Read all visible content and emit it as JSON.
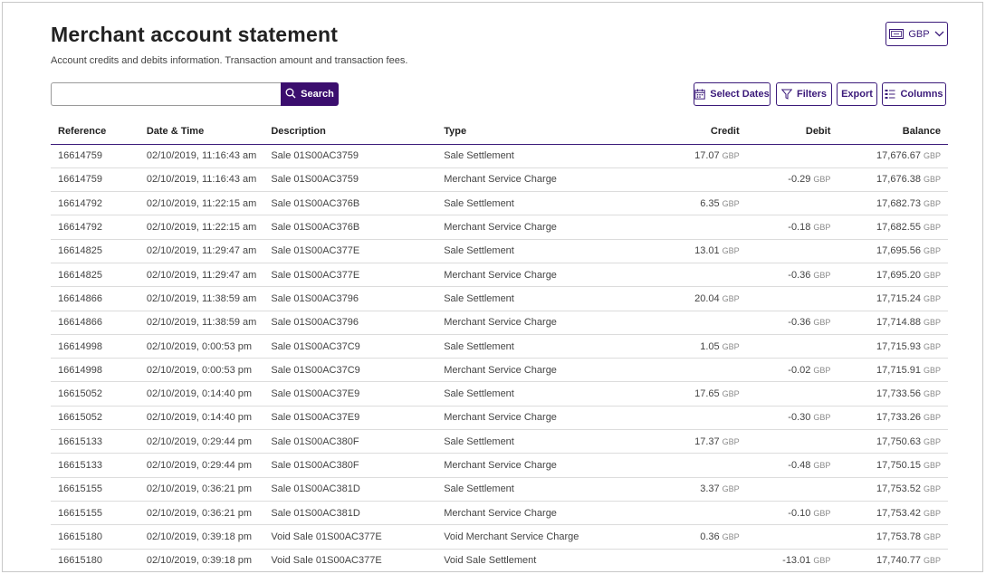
{
  "header": {
    "title": "Merchant account statement",
    "subtitle": "Account credits and debits information. Transaction amount and transaction fees.",
    "currency_label": "GBP"
  },
  "search": {
    "placeholder": "",
    "value": "",
    "button_label": "Search"
  },
  "toolbar": {
    "select_dates_label": "Select Dates",
    "filters_label": "Filters",
    "export_label": "Export",
    "columns_label": "Columns"
  },
  "colors": {
    "accent": "#3b0e6e",
    "border": "#3b1a7a"
  },
  "icons": {
    "currency": "banknote-icon",
    "dropdown": "chevron-down-icon",
    "search": "search-icon",
    "dates": "calendar-icon",
    "filters": "funnel-icon",
    "columns": "columns-icon"
  },
  "table": {
    "headers": [
      "Reference",
      "Date & Time",
      "Description",
      "Type",
      "Credit",
      "Debit",
      "Balance"
    ],
    "currency": "GBP",
    "rows": [
      {
        "ref": "16614759",
        "datetime": "02/10/2019, 11:16:43 am",
        "desc": "Sale 01S00AC3759",
        "type": "Sale Settlement",
        "credit": "17.07",
        "debit": "",
        "balance": "17,676.67"
      },
      {
        "ref": "16614759",
        "datetime": "02/10/2019, 11:16:43 am",
        "desc": "Sale 01S00AC3759",
        "type": "Merchant Service Charge",
        "credit": "",
        "debit": "-0.29",
        "balance": "17,676.38"
      },
      {
        "ref": "16614792",
        "datetime": "02/10/2019, 11:22:15 am",
        "desc": "Sale 01S00AC376B",
        "type": "Sale Settlement",
        "credit": "6.35",
        "debit": "",
        "balance": "17,682.73"
      },
      {
        "ref": "16614792",
        "datetime": "02/10/2019, 11:22:15 am",
        "desc": "Sale 01S00AC376B",
        "type": "Merchant Service Charge",
        "credit": "",
        "debit": "-0.18",
        "balance": "17,682.55"
      },
      {
        "ref": "16614825",
        "datetime": "02/10/2019, 11:29:47 am",
        "desc": "Sale 01S00AC377E",
        "type": "Sale Settlement",
        "credit": "13.01",
        "debit": "",
        "balance": "17,695.56"
      },
      {
        "ref": "16614825",
        "datetime": "02/10/2019, 11:29:47 am",
        "desc": "Sale 01S00AC377E",
        "type": "Merchant Service Charge",
        "credit": "",
        "debit": "-0.36",
        "balance": "17,695.20"
      },
      {
        "ref": "16614866",
        "datetime": "02/10/2019, 11:38:59 am",
        "desc": "Sale 01S00AC3796",
        "type": "Sale Settlement",
        "credit": "20.04",
        "debit": "",
        "balance": "17,715.24"
      },
      {
        "ref": "16614866",
        "datetime": "02/10/2019, 11:38:59 am",
        "desc": "Sale 01S00AC3796",
        "type": "Merchant Service Charge",
        "credit": "",
        "debit": "-0.36",
        "balance": "17,714.88"
      },
      {
        "ref": "16614998",
        "datetime": "02/10/2019, 0:00:53 pm",
        "desc": "Sale 01S00AC37C9",
        "type": "Sale Settlement",
        "credit": "1.05",
        "debit": "",
        "balance": "17,715.93"
      },
      {
        "ref": "16614998",
        "datetime": "02/10/2019, 0:00:53 pm",
        "desc": "Sale 01S00AC37C9",
        "type": "Merchant Service Charge",
        "credit": "",
        "debit": "-0.02",
        "balance": "17,715.91"
      },
      {
        "ref": "16615052",
        "datetime": "02/10/2019, 0:14:40 pm",
        "desc": "Sale 01S00AC37E9",
        "type": "Sale Settlement",
        "credit": "17.65",
        "debit": "",
        "balance": "17,733.56"
      },
      {
        "ref": "16615052",
        "datetime": "02/10/2019, 0:14:40 pm",
        "desc": "Sale 01S00AC37E9",
        "type": "Merchant Service Charge",
        "credit": "",
        "debit": "-0.30",
        "balance": "17,733.26"
      },
      {
        "ref": "16615133",
        "datetime": "02/10/2019, 0:29:44 pm",
        "desc": "Sale 01S00AC380F",
        "type": "Sale Settlement",
        "credit": "17.37",
        "debit": "",
        "balance": "17,750.63"
      },
      {
        "ref": "16615133",
        "datetime": "02/10/2019, 0:29:44 pm",
        "desc": "Sale 01S00AC380F",
        "type": "Merchant Service Charge",
        "credit": "",
        "debit": "-0.48",
        "balance": "17,750.15"
      },
      {
        "ref": "16615155",
        "datetime": "02/10/2019, 0:36:21 pm",
        "desc": "Sale 01S00AC381D",
        "type": "Sale Settlement",
        "credit": "3.37",
        "debit": "",
        "balance": "17,753.52"
      },
      {
        "ref": "16615155",
        "datetime": "02/10/2019, 0:36:21 pm",
        "desc": "Sale 01S00AC381D",
        "type": "Merchant Service Charge",
        "credit": "",
        "debit": "-0.10",
        "balance": "17,753.42"
      },
      {
        "ref": "16615180",
        "datetime": "02/10/2019, 0:39:18 pm",
        "desc": "Void Sale 01S00AC377E",
        "type": "Void Merchant Service Charge",
        "credit": "0.36",
        "debit": "",
        "balance": "17,753.78"
      },
      {
        "ref": "16615180",
        "datetime": "02/10/2019, 0:39:18 pm",
        "desc": "Void Sale 01S00AC377E",
        "type": "Void Sale Settlement",
        "credit": "",
        "debit": "-13.01",
        "balance": "17,740.77"
      }
    ]
  }
}
